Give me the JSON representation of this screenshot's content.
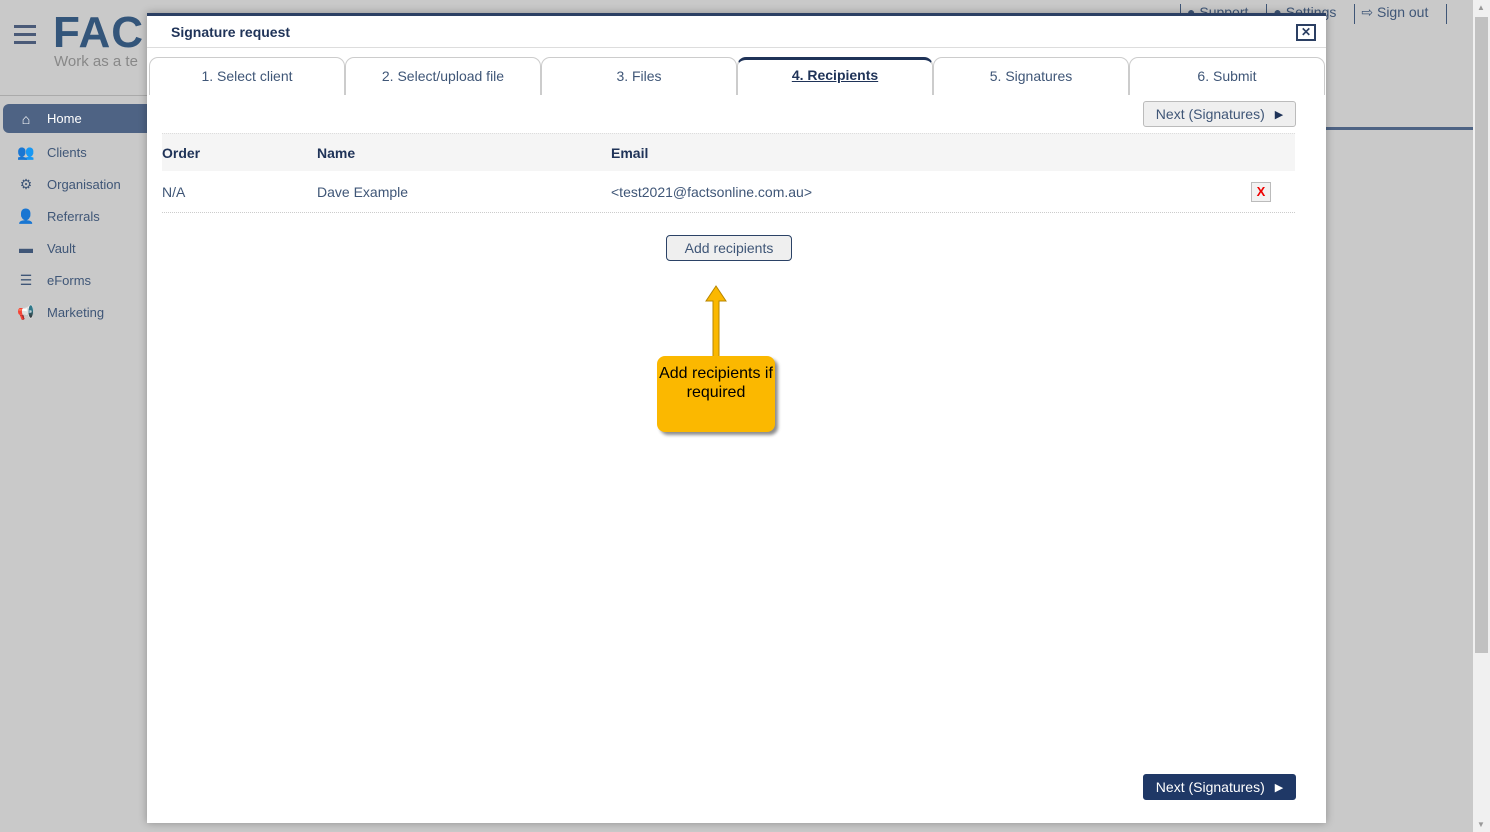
{
  "app": {
    "logo": "FAC",
    "tagline": "Work as a te"
  },
  "topnav": {
    "support": "Support",
    "settings": "Settings",
    "signout": "Sign out"
  },
  "sidebar": {
    "items": [
      {
        "label": "Home",
        "icon": "home-icon"
      },
      {
        "label": "Clients",
        "icon": "users-icon"
      },
      {
        "label": "Organisation",
        "icon": "users-cog-icon"
      },
      {
        "label": "Referrals",
        "icon": "user-friends-icon"
      },
      {
        "label": "Vault",
        "icon": "archive-icon"
      },
      {
        "label": "eForms",
        "icon": "list-icon"
      },
      {
        "label": "Marketing",
        "icon": "megaphone-icon"
      }
    ]
  },
  "modal": {
    "title": "Signature request",
    "close": "✕",
    "tabs": [
      "1. Select client",
      "2. Select/upload file",
      "3. Files",
      "4. Recipients",
      "5. Signatures",
      "6. Submit"
    ],
    "active_tab": "4. Recipients",
    "next_label": "Next (Signatures)",
    "table": {
      "headers": [
        "Order",
        "Name",
        "Email"
      ],
      "rows": [
        {
          "order": "N/A",
          "name": "Dave Example",
          "email": "<test2021@factsonline.com.au>",
          "delete": "X"
        }
      ]
    },
    "add_recipients": "Add recipients",
    "callout": "Add recipients if required"
  },
  "colors": {
    "primary": "#1f3866",
    "callout": "#fbb800",
    "delete": "#ee0000"
  }
}
